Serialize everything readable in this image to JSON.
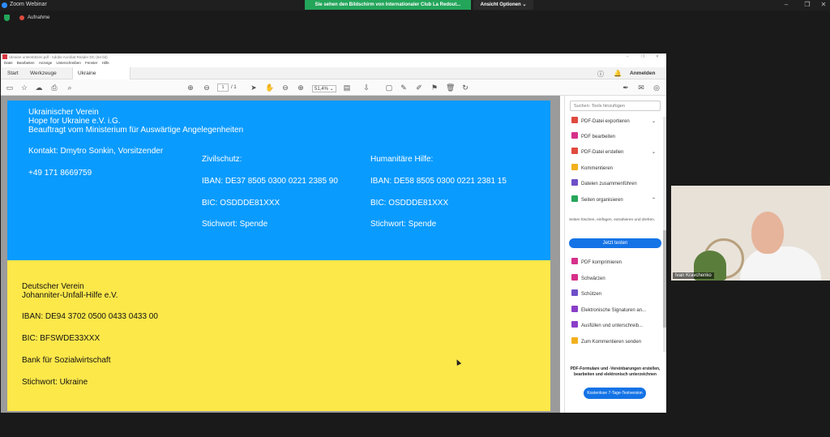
{
  "zoom": {
    "title": "Zoom Webinar",
    "share_banner": "Sie sehen den Bildschirm von Internationaler Club La Redout...",
    "view_options": "Ansicht Optionen",
    "view_options_icon": "chevron-down-icon",
    "recording_label": "Aufnahme"
  },
  "acrobat": {
    "window_title": "Ukraine unterstützen.pdf - Adobe Acrobat Reader DC (64-bit)",
    "menu": [
      "Datei",
      "Bearbeiten",
      "Anzeige",
      "Unterschreiben",
      "Fenster",
      "Hilfe"
    ],
    "tabs": [
      "Start",
      "Werkzeuge",
      "Ukraine unterstütz..."
    ],
    "signin_label": "Anmelden",
    "page_current": "1",
    "page_total": "/ 1",
    "zoom_level": "51,4%",
    "search_placeholder": "Suchen: Tools hinzufügen",
    "tools": [
      {
        "label": "PDF-Datei exportieren",
        "color": "#e04a3f",
        "chevron": "⌄"
      },
      {
        "label": "PDF bearbeiten",
        "color": "#d6308a",
        "chevron": ""
      },
      {
        "label": "PDF-Datei erstellen",
        "color": "#e04a3f",
        "chevron": "⌄"
      },
      {
        "label": "Kommentieren",
        "color": "#f2b01e",
        "chevron": ""
      },
      {
        "label": "Dateien zusammenführen",
        "color": "#6f4fc8",
        "chevron": ""
      },
      {
        "label": "Seiten organisieren",
        "color": "#26a65b",
        "chevron": "⌃"
      }
    ],
    "organize_desc": "Seiten löschen, einfügen, extrahieren und drehen.",
    "try_now": "Jetzt testen",
    "tools2": [
      {
        "label": "PDF komprimieren",
        "color": "#d6308a"
      },
      {
        "label": "Schwärzen",
        "color": "#d6308a"
      },
      {
        "label": "Schützen",
        "color": "#6f4fc8"
      },
      {
        "label": "Elektronische Signaturen an...",
        "color": "#8a3fc8"
      },
      {
        "label": "Ausfüllen und unterschreib...",
        "color": "#8a3fc8"
      },
      {
        "label": "Zum Kommentieren senden",
        "color": "#f2b01e"
      }
    ],
    "promo": "PDF-Formulare und -Vereinbarungen erstellen, bearbeiten und elektronisch unterzeichnen",
    "trial": "Kostenlose 7-Tage-Testversion"
  },
  "pdf": {
    "blue": {
      "org": "Ukrainischer Verein",
      "name": "Hope for Ukraine e.V. i.G.",
      "mandate": "Beauftragt vom Ministerium für Auswärtige Angelegenheiten",
      "contact": "Kontakt: Dmytro Sonkin, Vorsitzender",
      "phone": "+49 171 8669759",
      "col1_title": "Zivilschutz:",
      "col1_iban": "IBAN: DE37 8505 0300 0221 2385 90",
      "col1_bic": "BIC: OSDDDE81XXX",
      "col1_stich": "Stichwort: Spende",
      "col2_title": "Humanitäre Hilfe:",
      "col2_iban": "IBAN: DE58 8505 0300 0221 2381 15",
      "col2_bic": "BIC: OSDDDE81XXX",
      "col2_stich": "Stichwort: Spende"
    },
    "yellow": {
      "org": "Deutscher Verein",
      "name": "Johanniter-Unfall-Hilfe e.V.",
      "iban": "IBAN: DE94 3702 0500 0433 0433 00",
      "bic": "BIC: BFSWDE33XXX",
      "bank": "Bank für Sozialwirtschaft",
      "stich": "Stichwort: Ukraine"
    }
  },
  "video": {
    "participant_name": "Ivan Kravchenko"
  }
}
